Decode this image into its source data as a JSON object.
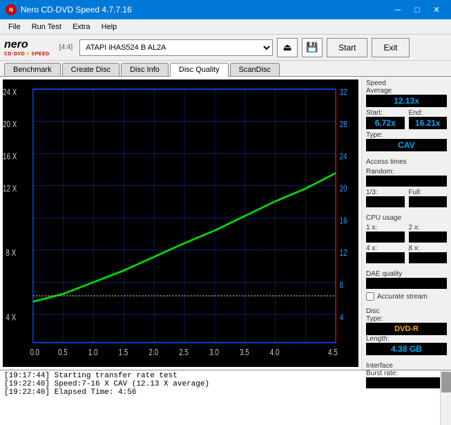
{
  "titlebar": {
    "title": "Nero CD-DVD Speed 4.7.7.16",
    "icon": "●",
    "controls": {
      "minimize": "─",
      "maximize": "□",
      "close": "✕"
    }
  },
  "menubar": {
    "items": [
      "File",
      "Run Test",
      "Extra",
      "Help"
    ]
  },
  "toolbar": {
    "bracket_label": "[4:4]",
    "device": "ATAPI iHAS524  B  AL2A",
    "start_label": "Start",
    "exit_label": "Exit"
  },
  "tabs": [
    {
      "label": "Benchmark",
      "active": false
    },
    {
      "label": "Create Disc",
      "active": false
    },
    {
      "label": "Disc Info",
      "active": false
    },
    {
      "label": "Disc Quality",
      "active": true
    },
    {
      "label": "ScanDisc",
      "active": false
    }
  ],
  "right_panel": {
    "speed_section": {
      "title": "Speed",
      "average_label": "Average",
      "average_value": "12.13x",
      "start_label": "Start:",
      "start_value": "6.72x",
      "end_label": "End:",
      "end_value": "16.21x",
      "type_label": "Type:",
      "type_value": "CAV"
    },
    "access_times": {
      "title": "Access times",
      "random_label": "Random:",
      "random_value": "",
      "onethird_label": "1/3:",
      "onethird_value": "",
      "full_label": "Full:",
      "full_value": ""
    },
    "cpu_usage": {
      "title": "CPU usage",
      "one_label": "1 x:",
      "one_value": "",
      "two_label": "2 x:",
      "two_value": "",
      "four_label": "4 x:",
      "four_value": "",
      "eight_label": "8 x:",
      "eight_value": ""
    },
    "dae_quality": {
      "title": "DAE quality",
      "value": ""
    },
    "accurate_stream": {
      "title": "Accurate stream",
      "checked": false
    },
    "disc": {
      "title": "Disc",
      "type_label": "Type:",
      "type_value": "DVD-R",
      "length_label": "Length:",
      "length_value": "4.38 GB"
    },
    "interface": {
      "title": "Interface",
      "burst_label": "Burst rate:",
      "burst_value": ""
    }
  },
  "chart": {
    "y_labels": [
      "32",
      "28",
      "24",
      "20",
      "16",
      "12",
      "8",
      "4"
    ],
    "y_labels_left": [
      "24 X",
      "20 X",
      "16 X",
      "12 X",
      "8 X",
      "4 X"
    ],
    "x_labels": [
      "0.0",
      "0.5",
      "1.0",
      "1.5",
      "2.0",
      "2.5",
      "3.0",
      "3.5",
      "4.0",
      "4.5"
    ],
    "grid_color": "#003366",
    "curve_color": "#00cc00",
    "flat_line_color": "#cccccc"
  },
  "log": {
    "lines": [
      "[19:17:44]  Starting transfer rate test",
      "[19:22:40]  Speed:7-16 X CAV (12.13 X average)",
      "[19:22:40]  Elapsed Time: 4:56"
    ]
  }
}
